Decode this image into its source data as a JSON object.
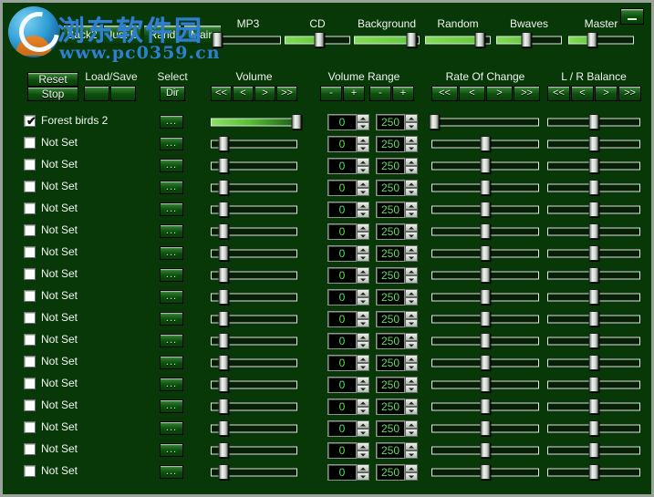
{
  "window": {
    "minimize_label": "minimize-icon"
  },
  "tabs": [
    {
      "id": "back1",
      "label": "Back1"
    },
    {
      "id": "back2",
      "label": "Back2"
    },
    {
      "id": "justb",
      "label": "Just B"
    },
    {
      "id": "rand",
      "label": "Rand"
    },
    {
      "id": "main",
      "label": "Main"
    }
  ],
  "master_sliders": [
    {
      "id": "mp3",
      "label": "MP3",
      "value": 2
    },
    {
      "id": "cd",
      "label": "CD",
      "value": 53
    },
    {
      "id": "background",
      "label": "Background",
      "value": 88
    },
    {
      "id": "random",
      "label": "Random",
      "value": 84
    },
    {
      "id": "bwaves",
      "label": "Bwaves",
      "value": 46
    },
    {
      "id": "master",
      "label": "Master",
      "value": 36
    }
  ],
  "controls": {
    "reset_label": "Reset",
    "stop_label": "Stop",
    "loadsave_label": "Load/Save",
    "load_label": "",
    "save_label": "",
    "select_label": "Select",
    "dir_label": "Dir"
  },
  "columns": {
    "volume": {
      "label": "Volume",
      "buttons": [
        "<<",
        "<",
        ">",
        ">>"
      ]
    },
    "volume_range": {
      "label": "Volume Range",
      "buttons_min": [
        "-",
        "+"
      ],
      "buttons_max": [
        "-",
        "+"
      ]
    },
    "rate_of_change": {
      "label": "Rate Of Change",
      "buttons": [
        "<<",
        "<",
        ">",
        ">>"
      ]
    },
    "lr_balance": {
      "label": "L / R Balance",
      "buttons": [
        "<<",
        "<",
        ">",
        ">>"
      ]
    }
  },
  "row_defaults": {
    "dots_label": "...",
    "min_value": "0",
    "max_value": "250"
  },
  "rows": [
    {
      "checked": true,
      "label": "Forest birds 2",
      "dots": "...",
      "volume": 100,
      "min": "0",
      "max": "250",
      "rate": 2,
      "balance": 50
    },
    {
      "checked": false,
      "label": "Not Set",
      "dots": "...",
      "volume": 14,
      "min": "0",
      "max": "250",
      "rate": 50,
      "balance": 50
    },
    {
      "checked": false,
      "label": "Not Set",
      "dots": "...",
      "volume": 14,
      "min": "0",
      "max": "250",
      "rate": 50,
      "balance": 50
    },
    {
      "checked": false,
      "label": "Not Set",
      "dots": "...",
      "volume": 14,
      "min": "0",
      "max": "250",
      "rate": 50,
      "balance": 50
    },
    {
      "checked": false,
      "label": "Not Set",
      "dots": "...",
      "volume": 14,
      "min": "0",
      "max": "250",
      "rate": 50,
      "balance": 50
    },
    {
      "checked": false,
      "label": "Not Set",
      "dots": "...",
      "volume": 14,
      "min": "0",
      "max": "250",
      "rate": 50,
      "balance": 50
    },
    {
      "checked": false,
      "label": "Not Set",
      "dots": "...",
      "volume": 14,
      "min": "0",
      "max": "250",
      "rate": 50,
      "balance": 50
    },
    {
      "checked": false,
      "label": "Not Set",
      "dots": "...",
      "volume": 14,
      "min": "0",
      "max": "250",
      "rate": 50,
      "balance": 50
    },
    {
      "checked": false,
      "label": "Not Set",
      "dots": "...",
      "volume": 14,
      "min": "0",
      "max": "250",
      "rate": 50,
      "balance": 50
    },
    {
      "checked": false,
      "label": "Not Set",
      "dots": "...",
      "volume": 14,
      "min": "0",
      "max": "250",
      "rate": 50,
      "balance": 50
    },
    {
      "checked": false,
      "label": "Not Set",
      "dots": "...",
      "volume": 14,
      "min": "0",
      "max": "250",
      "rate": 50,
      "balance": 50
    },
    {
      "checked": false,
      "label": "Not Set",
      "dots": "...",
      "volume": 14,
      "min": "0",
      "max": "250",
      "rate": 50,
      "balance": 50
    },
    {
      "checked": false,
      "label": "Not Set",
      "dots": "...",
      "volume": 14,
      "min": "0",
      "max": "250",
      "rate": 50,
      "balance": 50
    },
    {
      "checked": false,
      "label": "Not Set",
      "dots": "...",
      "volume": 14,
      "min": "0",
      "max": "250",
      "rate": 50,
      "balance": 50
    },
    {
      "checked": false,
      "label": "Not Set",
      "dots": "...",
      "volume": 14,
      "min": "0",
      "max": "250",
      "rate": 50,
      "balance": 50
    },
    {
      "checked": false,
      "label": "Not Set",
      "dots": "...",
      "volume": 14,
      "min": "0",
      "max": "250",
      "rate": 50,
      "balance": 50
    },
    {
      "checked": false,
      "label": "Not Set",
      "dots": "...",
      "volume": 14,
      "min": "0",
      "max": "250",
      "rate": 50,
      "balance": 50
    }
  ],
  "watermark": {
    "chinese": "浏东软件园",
    "url": "www.pc0359.cn"
  },
  "colors": {
    "background": "#083708",
    "accent_green": "#5ce05c",
    "slider_fill": "#64c93f",
    "text": "#f0f6f0"
  }
}
